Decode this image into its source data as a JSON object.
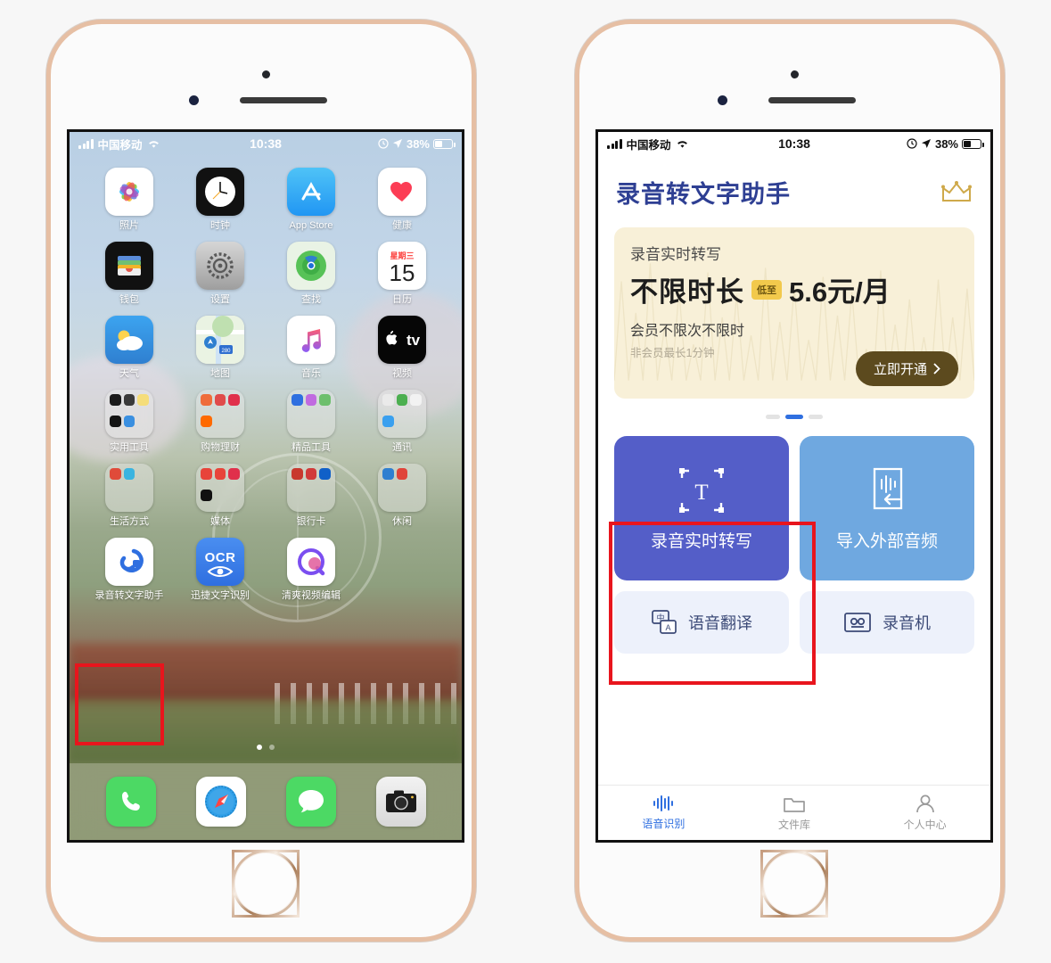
{
  "status_bar": {
    "carrier": "中国移动",
    "time": "10:38",
    "battery_percent": "38%",
    "signal_icon": "signal-bars-icon",
    "wifi_icon": "wifi-icon",
    "alarm_icon": "alarm-icon",
    "location_icon": "location-arrow-icon",
    "battery_icon": "battery-icon"
  },
  "home_screen": {
    "rows": [
      [
        {
          "label": "照片",
          "icon": "photos-icon"
        },
        {
          "label": "时钟",
          "icon": "clock-icon"
        },
        {
          "label": "App Store",
          "icon": "app-store-icon"
        },
        {
          "label": "健康",
          "icon": "health-icon"
        }
      ],
      [
        {
          "label": "钱包",
          "icon": "wallet-icon"
        },
        {
          "label": "设置",
          "icon": "settings-icon"
        },
        {
          "label": "查找",
          "icon": "find-my-icon"
        },
        {
          "label": "日历",
          "icon": "calendar-icon",
          "weekday": "星期三",
          "day": "15"
        }
      ],
      [
        {
          "label": "天气",
          "icon": "weather-icon"
        },
        {
          "label": "地图",
          "icon": "maps-icon"
        },
        {
          "label": "音乐",
          "icon": "music-icon"
        },
        {
          "label": "视频",
          "icon": "apple-tv-icon"
        }
      ],
      [
        {
          "label": "实用工具",
          "icon": "folder-icon"
        },
        {
          "label": "购物理财",
          "icon": "folder-icon"
        },
        {
          "label": "精品工具",
          "icon": "folder-icon"
        },
        {
          "label": "通讯",
          "icon": "folder-icon"
        }
      ],
      [
        {
          "label": "生活方式",
          "icon": "folder-icon"
        },
        {
          "label": "媒体",
          "icon": "folder-icon"
        },
        {
          "label": "银行卡",
          "icon": "folder-icon"
        },
        {
          "label": "休闲",
          "icon": "folder-icon"
        }
      ],
      [
        {
          "label": "录音转文字助手",
          "icon": "voice-to-text-app-icon",
          "highlighted": true
        },
        {
          "label": "迅捷文字识别",
          "icon": "ocr-app-icon"
        },
        {
          "label": "清爽视频编辑",
          "icon": "video-editor-app-icon"
        },
        {
          "label": "",
          "icon": "empty"
        }
      ]
    ],
    "dock": [
      {
        "label": "电话",
        "icon": "phone-icon"
      },
      {
        "label": "Safari",
        "icon": "safari-icon"
      },
      {
        "label": "信息",
        "icon": "messages-icon"
      },
      {
        "label": "相机",
        "icon": "camera-icon"
      }
    ],
    "page_dots": {
      "count": 2,
      "active_index": 0
    }
  },
  "app_screen": {
    "title": "录音转文字助手",
    "vip_icon": "crown-icon",
    "banner": {
      "subtitle": "录音实时转写",
      "headline": "不限时长",
      "badge": "低至",
      "price": "5.6元/月",
      "line1": "会员不限次不限时",
      "line2": "非会员最长1分钟",
      "cta": "立即开通",
      "cta_arrow_icon": "chevron-right-icon"
    },
    "carousel": {
      "count": 3,
      "active_index": 1
    },
    "primary_tiles": [
      {
        "label": "录音实时转写",
        "icon": "text-recognition-icon",
        "color": "#545ec8",
        "highlighted": true
      },
      {
        "label": "导入外部音频",
        "icon": "import-audio-icon",
        "color": "#6fa8e0",
        "highlighted": false
      }
    ],
    "secondary_tiles": [
      {
        "label": "语音翻译",
        "icon": "translate-icon"
      },
      {
        "label": "录音机",
        "icon": "cassette-recorder-icon"
      }
    ],
    "tabs": [
      {
        "label": "语音识别",
        "icon": "waveform-icon",
        "active": true
      },
      {
        "label": "文件库",
        "icon": "folder-icon",
        "active": false
      },
      {
        "label": "个人中心",
        "icon": "person-icon",
        "active": false
      }
    ]
  },
  "colors": {
    "accent_blue": "#2f6fe0",
    "title_blue": "#2e3f93",
    "tile_purple": "#545ec8",
    "tile_blue": "#6fa8e0",
    "banner_bg": "#f8f0d8",
    "cta_brown": "#5c4a1e",
    "highlight_red": "#e8151d"
  }
}
